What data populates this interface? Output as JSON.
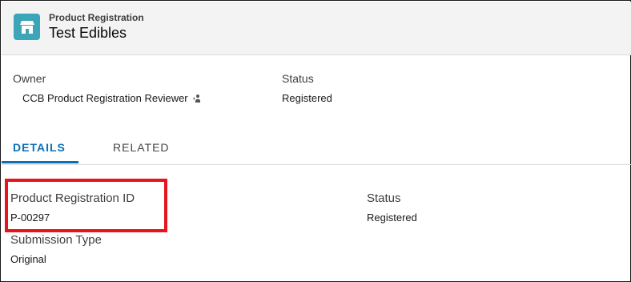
{
  "header": {
    "icon": "shop-icon",
    "object_label": "Product Registration",
    "record_title": "Test Edibles",
    "icon_color": "#3ba6b8"
  },
  "highlights": {
    "owner_label": "Owner",
    "owner_value": "CCB Product Registration Reviewer",
    "status_label": "Status",
    "status_value": "Registered"
  },
  "tabs": [
    {
      "label": "DETAILS",
      "active": true
    },
    {
      "label": "RELATED",
      "active": false
    }
  ],
  "details": {
    "registration_id_label": "Product Registration ID",
    "registration_id_value": "P-00297",
    "status_label": "Status",
    "status_value": "Registered",
    "submission_type_label": "Submission Type",
    "submission_type_value": "Original"
  },
  "colors": {
    "accent": "#0b6fb8",
    "highlight_border": "#e8131c"
  }
}
